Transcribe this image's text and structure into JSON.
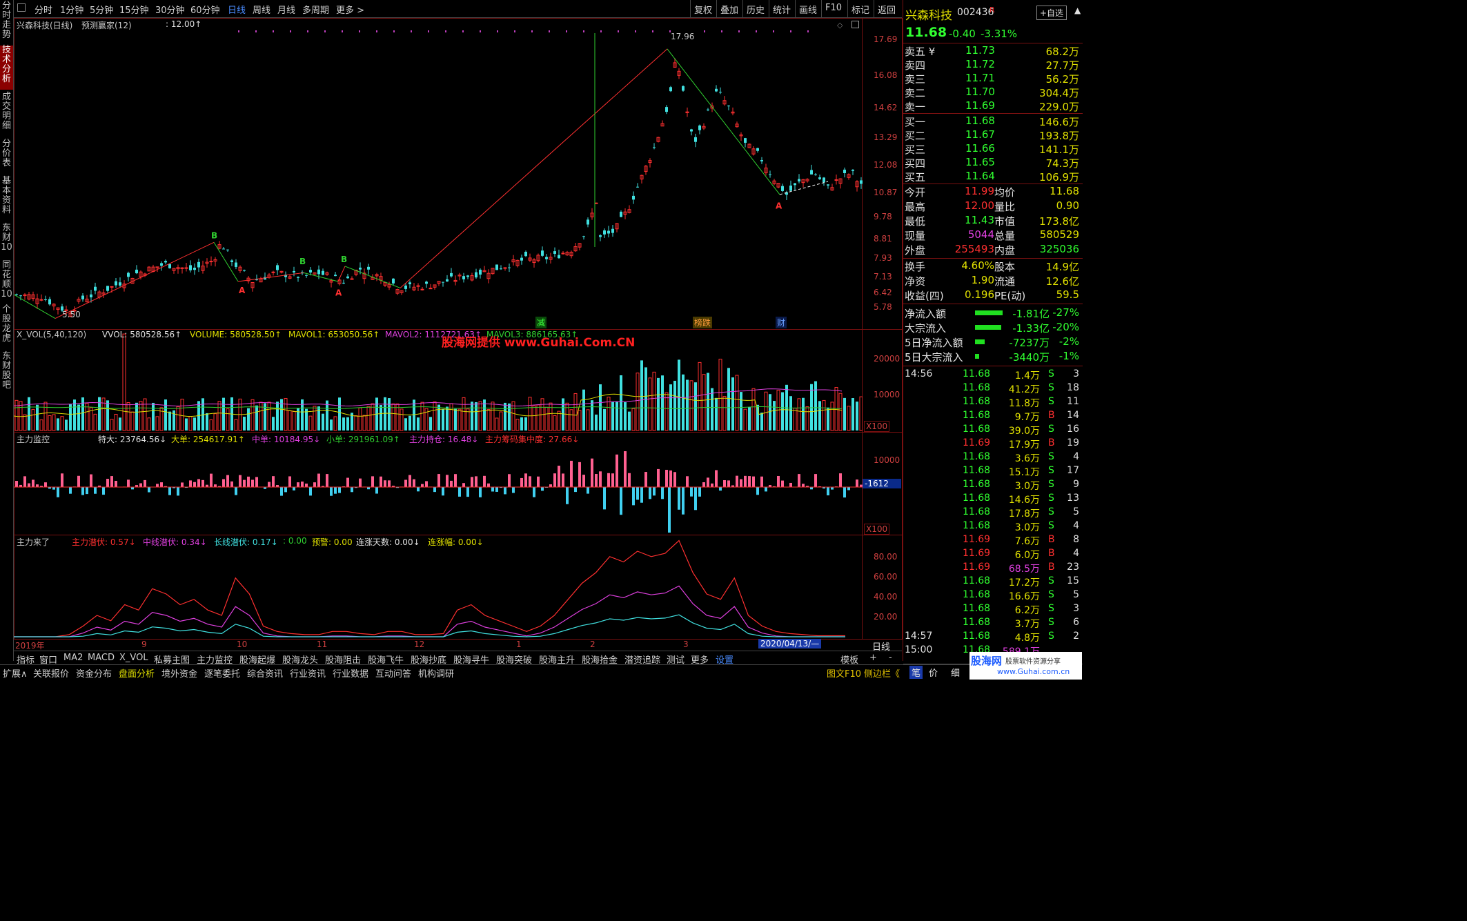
{
  "left_tabs": [
    "分时走势",
    "技术分析",
    "成交明细",
    "分价表",
    "基本资料",
    "东财10",
    "同花顺10",
    "个股龙虎",
    "东财股吧"
  ],
  "periods": [
    "分时",
    "1分钟",
    "5分钟",
    "15分钟",
    "30分钟",
    "60分钟",
    "日线",
    "周线",
    "月线",
    "多周期",
    "更多 >"
  ],
  "top_right": [
    "复权",
    "叠加",
    "历史",
    "统计",
    "画线",
    "F10",
    "标记",
    "返回"
  ],
  "chart_title": {
    "stock": "兴森科技(日线)",
    "indicator": "预测赢家(12)",
    "value": ": 12.00↑"
  },
  "price_axis": [
    "17.69",
    "16.08",
    "14.62",
    "13.29",
    "12.08",
    "10.87",
    "9.78",
    "8.81",
    "7.93",
    "7.13",
    "6.42",
    "5.78"
  ],
  "price_marks": {
    "high": "17.96",
    "low": "5.50",
    "low_label": "5.50"
  },
  "event_labels": {
    "e1": "减",
    "e2": "榜跌",
    "e3": "财"
  },
  "vol_panel": {
    "name": "X_VOL(5,40,120)",
    "vvol": "VVOL: 580528.56↑",
    "volume": "VOLUME: 580528.50↑",
    "mavol1": "MAVOL1: 653050.56↑",
    "mavol2": "MAVOL2: 1112721.63↑",
    "mavol3": "MAVOL3: 886165.63↑",
    "axis": [
      "20000",
      "10000"
    ],
    "unit": "X100"
  },
  "watermark": "股海网提供 www.Guhai.Com.CN",
  "main_panel": {
    "name": "主力监控",
    "te": "特大: 23764.56↓",
    "da": "大单: 254617.91↑",
    "zhong": "中单: 10184.95↓",
    "xiao": "小单: 291961.09↑",
    "chicang": "主力持仓: 16.48↓",
    "jizhong": "主力筹码集中度: 27.66↓",
    "axis": [
      "10000"
    ],
    "current": "-1612",
    "unit": "X100"
  },
  "lai_panel": {
    "name": "主力来了",
    "qianfu": "主力潜伏: 0.57↓",
    "zhongxian": "中线潜伏: 0.34↓",
    "changxian": "长线潜伏: 0.17↓",
    "blank": ": 0.00",
    "yujing": "预警: 0.00",
    "lianzhang": "连涨天数: 0.00↓",
    "lianfu": "连涨幅: 0.00↓",
    "axis": [
      "80.00",
      "60.00",
      "40.00",
      "20.00"
    ]
  },
  "date_axis": [
    "2019年",
    "9",
    "10",
    "11",
    "12",
    "1",
    "2",
    "3"
  ],
  "date_cursor": "2020/04/13/—",
  "date_mode": "日线",
  "bottom_tabs": [
    "指标",
    "窗口",
    "MA2",
    "MACD",
    "X_VOL",
    "私募主图",
    "主力监控",
    "股海起爆",
    "股海龙头",
    "股海阻击",
    "股海飞牛",
    "股海抄底",
    "股海寻牛",
    "股海突破",
    "股海主升",
    "股海拾金",
    "潜资追踪",
    "测试",
    "更多",
    "设置"
  ],
  "bottom_right": [
    "模板",
    "+",
    "-"
  ],
  "bottom_bar": [
    "扩展∧",
    "关联报价",
    "资金分布",
    "盘面分析",
    "境外资金",
    "逐笔委托",
    "综合资讯",
    "行业资讯",
    "行业数据",
    "互动问答",
    "机构调研"
  ],
  "bottom_bar_right": [
    "图文F10",
    "侧边栏《"
  ],
  "right_panel": {
    "name": "兴森科技",
    "code": "002436",
    "r": "R",
    "self_select": "+自选",
    "price": "11.68",
    "change": "-0.40",
    "pct": "-3.31%",
    "sells": [
      [
        "卖五 ¥",
        "11.73",
        "68.2万"
      ],
      [
        "卖四",
        "11.72",
        "27.7万"
      ],
      [
        "卖三",
        "11.71",
        "56.2万"
      ],
      [
        "卖二",
        "11.70",
        "304.4万"
      ],
      [
        "卖一",
        "11.69",
        "229.0万"
      ]
    ],
    "buys": [
      [
        "买一",
        "11.68",
        "146.6万"
      ],
      [
        "买二",
        "11.67",
        "193.8万"
      ],
      [
        "买三",
        "11.66",
        "141.1万"
      ],
      [
        "买四",
        "11.65",
        "74.3万"
      ],
      [
        "买五",
        "11.64",
        "106.9万"
      ]
    ],
    "stats": [
      [
        "今开",
        "11.99",
        "均价",
        "11.68"
      ],
      [
        "最高",
        "12.00",
        "量比",
        "0.90"
      ],
      [
        "最低",
        "11.43",
        "市值",
        "173.8亿"
      ],
      [
        "现量",
        "5044",
        "总量",
        "580529"
      ],
      [
        "外盘",
        "255493",
        "内盘",
        "325036"
      ]
    ],
    "stats2": [
      [
        "换手",
        "4.60%",
        "股本",
        "14.9亿"
      ],
      [
        "净资",
        "1.90",
        "流通",
        "12.6亿"
      ],
      [
        "收益(四)",
        "0.196",
        "PE(动)",
        "59.5"
      ]
    ],
    "flows": [
      [
        "净流入额",
        "-1.81亿",
        "-27%"
      ],
      [
        "大宗流入",
        "-1.33亿",
        "-20%"
      ],
      [
        "5日净流入额",
        "-7237万",
        "-2%"
      ],
      [
        "5日大宗流入",
        "-3440万",
        "-1%"
      ]
    ],
    "ticks": [
      [
        "14:56",
        "11.68",
        "1.4万",
        "S",
        "3"
      ],
      [
        "",
        "11.68",
        "41.2万",
        "S",
        "18"
      ],
      [
        "",
        "11.68",
        "11.8万",
        "S",
        "11"
      ],
      [
        "",
        "11.68",
        "9.7万",
        "B",
        "14"
      ],
      [
        "",
        "11.68",
        "39.0万",
        "S",
        "16"
      ],
      [
        "",
        "11.69",
        "17.9万",
        "B",
        "19"
      ],
      [
        "",
        "11.68",
        "3.6万",
        "S",
        "4"
      ],
      [
        "",
        "11.68",
        "15.1万",
        "S",
        "17"
      ],
      [
        "",
        "11.68",
        "3.0万",
        "S",
        "9"
      ],
      [
        "",
        "11.68",
        "14.6万",
        "S",
        "13"
      ],
      [
        "",
        "11.68",
        "17.8万",
        "S",
        "5"
      ],
      [
        "",
        "11.68",
        "3.0万",
        "S",
        "4"
      ],
      [
        "",
        "11.69",
        "7.6万",
        "B",
        "8"
      ],
      [
        "",
        "11.69",
        "6.0万",
        "B",
        "4"
      ],
      [
        "",
        "11.69",
        "68.5万",
        "B",
        "23"
      ],
      [
        "",
        "11.68",
        "17.2万",
        "S",
        "15"
      ],
      [
        "",
        "11.68",
        "16.6万",
        "S",
        "5"
      ],
      [
        "",
        "11.68",
        "6.2万",
        "S",
        "3"
      ],
      [
        "",
        "11.68",
        "3.7万",
        "S",
        "6"
      ],
      [
        "14:57",
        "11.68",
        "4.8万",
        "S",
        "2"
      ],
      [
        "15:00",
        "11.68",
        "589.1万",
        "",
        ""
      ]
    ],
    "bottom": [
      "笔",
      "价",
      "细"
    ],
    "logo": "股海网",
    "logo_sub": "股票软件资源分享",
    "logo_url": "www.Guhai.com.cn"
  }
}
